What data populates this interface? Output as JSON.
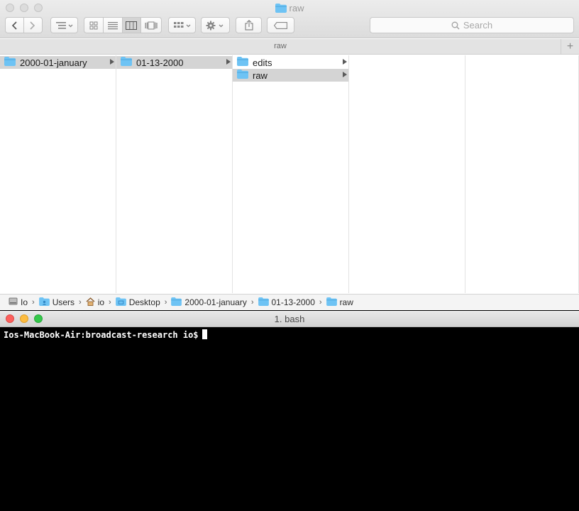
{
  "finder": {
    "title": "raw",
    "search_placeholder": "Search",
    "tab_label": "raw",
    "tab_add": "+",
    "columns": [
      {
        "items": [
          {
            "label": "2000-01-january",
            "selected": true,
            "has_children": true
          }
        ]
      },
      {
        "items": [
          {
            "label": "01-13-2000",
            "selected": true,
            "has_children": true
          }
        ]
      },
      {
        "items": [
          {
            "label": "edits",
            "selected": false,
            "has_children": true
          },
          {
            "label": "raw",
            "selected": true,
            "has_children": true
          }
        ]
      },
      {
        "items": []
      },
      {
        "items": []
      }
    ],
    "path": [
      {
        "label": "Io",
        "icon": "hard-drive-icon"
      },
      {
        "label": "Users",
        "icon": "users-folder-icon"
      },
      {
        "label": "io",
        "icon": "home-icon"
      },
      {
        "label": "Desktop",
        "icon": "desktop-folder-icon"
      },
      {
        "label": "2000-01-january",
        "icon": "folder-icon"
      },
      {
        "label": "01-13-2000",
        "icon": "folder-icon"
      },
      {
        "label": "raw",
        "icon": "folder-icon"
      }
    ]
  },
  "terminal": {
    "title": "1. bash",
    "prompt": "Ios-MacBook-Air:broadcast-research io$"
  },
  "colors": {
    "folder": "#6ec3f4",
    "selection": "#d4d4d4",
    "terminal_bg": "#000000",
    "close": "#fc605c",
    "minimize": "#fdbc40",
    "zoom": "#34c84a"
  }
}
